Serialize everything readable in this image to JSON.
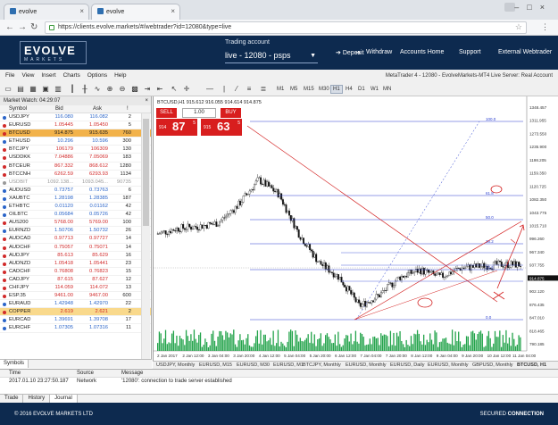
{
  "browser": {
    "tabs": [
      {
        "label": "evolve"
      },
      {
        "label": "evolve"
      }
    ],
    "url": "https://clients.evolve.markets/#/webtrader?id=12080&type=live"
  },
  "header": {
    "logo_main": "EVOLVE",
    "logo_sub": "MARKETS",
    "account_label": "Trading account",
    "account_value": "live - 12080 - psps",
    "nav": [
      "Deposit",
      "Withdraw",
      "Accounts Home",
      "Support",
      "External Webtrader"
    ]
  },
  "mt_menu": {
    "items": [
      "File",
      "View",
      "Insert",
      "Charts",
      "Options",
      "Help"
    ],
    "status": "MetaTrader 4 - 12080 - EvolveMarkets-MT4 Live Server: Real Account"
  },
  "timeframes": [
    "M1",
    "M5",
    "M15",
    "M30",
    "H1",
    "H4",
    "D1",
    "W1",
    "MN"
  ],
  "active_timeframe": "H1",
  "market_watch": {
    "title": "Market Watch: 04:29:07",
    "columns": [
      "Symbol",
      "Bid",
      "Ask",
      "!"
    ],
    "rows": [
      {
        "symbol": "USDJPY",
        "bid": "116.080",
        "ask": "116.082",
        "spread": "2",
        "color": "#2a64c8"
      },
      {
        "symbol": "EURUSD",
        "bid": "1.05445",
        "ask": "1.05450",
        "spread": "5",
        "color": "#d12a2a"
      },
      {
        "symbol": "BTCUSD",
        "bid": "914.875",
        "ask": "915.635",
        "spread": "760",
        "color": "#d12a2a",
        "highlight": true
      },
      {
        "symbol": "ETHUSD",
        "bid": "10.296",
        "ask": "10.596",
        "spread": "300",
        "color": "#2a64c8"
      },
      {
        "symbol": "BTCJPY",
        "bid": "106179",
        "ask": "106309",
        "spread": "130",
        "color": "#d12a2a"
      },
      {
        "symbol": "USDDKK",
        "bid": "7.04886",
        "ask": "7.05069",
        "spread": "183",
        "color": "#d12a2a"
      },
      {
        "symbol": "BTCEUR",
        "bid": "867.332",
        "ask": "868.612",
        "spread": "1280",
        "color": "#d12a2a"
      },
      {
        "symbol": "BTCCNH",
        "bid": "6262.59",
        "ask": "6293.93",
        "spread": "1134",
        "color": "#d12a2a"
      },
      {
        "symbol": "USDBIT",
        "bid": "1092.138...",
        "ask": "1093.045...",
        "spread": "90735",
        "color": "#999999",
        "grey": true
      },
      {
        "symbol": "AUDUSD",
        "bid": "0.73757",
        "ask": "0.73763",
        "spread": "6",
        "color": "#2a64c8"
      },
      {
        "symbol": "XAUBTC",
        "bid": "1.28198",
        "ask": "1.28385",
        "spread": "187",
        "color": "#2a64c8"
      },
      {
        "symbol": "ETHBTC",
        "bid": "0.01120",
        "ask": "0.01162",
        "spread": "42",
        "color": "#2a64c8"
      },
      {
        "symbol": "OILBTC",
        "bid": "0.05684",
        "ask": "0.05726",
        "spread": "42",
        "color": "#2a64c8"
      },
      {
        "symbol": "AUS200",
        "bid": "5768.00",
        "ask": "5769.00",
        "spread": "100",
        "color": "#d12a2a"
      },
      {
        "symbol": "EURNZD",
        "bid": "1.50706",
        "ask": "1.50732",
        "spread": "26",
        "color": "#2a64c8"
      },
      {
        "symbol": "AUDCAD",
        "bid": "0.97713",
        "ask": "0.97727",
        "spread": "14",
        "color": "#d12a2a"
      },
      {
        "symbol": "AUDCHF",
        "bid": "0.75057",
        "ask": "0.75071",
        "spread": "14",
        "color": "#d12a2a"
      },
      {
        "symbol": "AUDJPY",
        "bid": "85.613",
        "ask": "85.629",
        "spread": "16",
        "color": "#d12a2a"
      },
      {
        "symbol": "AUDNZD",
        "bid": "1.05418",
        "ask": "1.05441",
        "spread": "23",
        "color": "#d12a2a"
      },
      {
        "symbol": "CADCHF",
        "bid": "0.76808",
        "ask": "0.76823",
        "spread": "15",
        "color": "#d12a2a"
      },
      {
        "symbol": "CADJPY",
        "bid": "87.615",
        "ask": "87.627",
        "spread": "12",
        "color": "#d12a2a"
      },
      {
        "symbol": "CHFJPY",
        "bid": "114.059",
        "ask": "114.072",
        "spread": "13",
        "color": "#d12a2a"
      },
      {
        "symbol": "ESP.35",
        "bid": "9461.00",
        "ask": "9467.00",
        "spread": "600",
        "color": "#d12a2a"
      },
      {
        "symbol": "EURAUD",
        "bid": "1.42948",
        "ask": "1.42970",
        "spread": "22",
        "color": "#2a64c8"
      },
      {
        "symbol": "COPPER",
        "bid": "2.619",
        "ask": "2.621",
        "spread": "2",
        "color": "#d12a2a",
        "amber": true
      },
      {
        "symbol": "EURCAD",
        "bid": "1.39691",
        "ask": "1.39708",
        "spread": "17",
        "color": "#2a64c8"
      },
      {
        "symbol": "EURCHF",
        "bid": "1.07305",
        "ask": "1.07316",
        "spread": "11",
        "color": "#2a64c8"
      }
    ],
    "tab": "Symbols"
  },
  "chart": {
    "header": "BTCUSD,H1  915.612 916.055 914.614 914.875",
    "sell_label": "SELL",
    "buy_label": "BUY",
    "quantity": "1.00",
    "sell_price_small": "914",
    "sell_price_big": "87",
    "sell_price_sup": "5",
    "buy_price_small": "915",
    "buy_price_big": "63",
    "buy_price_sup": "5",
    "price_axis": [
      "1348.457",
      "1311.955",
      "1273.550",
      "1235.900",
      "1198.205",
      "1159.350",
      "1120.725",
      "1082.350",
      "1043.775",
      "1015.710",
      "996.260",
      "967.340",
      "937.755",
      "914.875",
      "902.120",
      "876.435",
      "847.010",
      "818.465",
      "790.185"
    ],
    "time_axis": [
      "2 Jan 2017",
      "2 Jan 12:00",
      "3 Jan 04:00",
      "3 Jan 20:00",
      "4 Jan 12:00",
      "5 Jan 04:00",
      "5 Jan 20:00",
      "6 Jan 12:00",
      "7 Jan 04:00",
      "7 Jan 20:00",
      "8 Jan 12:00",
      "9 Jan 04:00",
      "9 Jan 20:00",
      "10 Jan 12:00",
      "11 Jan 04:00"
    ],
    "fib_labels": [
      "100.0",
      "61.8",
      "50.0",
      "38.2",
      "23.6",
      "0.0"
    ],
    "tabs": [
      "USDJPY, Monthly",
      "EURUSD, M15",
      "EURUSD, M30",
      "EURUSD, M1",
      "BTCJPY, Monthly",
      "EURUSD, Monthly",
      "EURUSD, Daily",
      "EURUSD, Monthly",
      "GBPUSD, Monthly",
      "BTCUSD, H1"
    ]
  },
  "chart_data": {
    "type": "candlestick",
    "symbol": "BTCUSD",
    "timeframe": "H1",
    "x": [
      "2 Jan 2017",
      "2 Jan 12:00",
      "3 Jan 04:00",
      "3 Jan 20:00",
      "4 Jan 12:00",
      "5 Jan 04:00",
      "5 Jan 20:00",
      "6 Jan 12:00",
      "7 Jan 04:00",
      "7 Jan 20:00",
      "8 Jan 12:00",
      "9 Jan 04:00",
      "9 Jan 20:00",
      "10 Jan 12:00",
      "11 Jan 04:00"
    ],
    "close": [
      1000,
      1015,
      1020,
      1030,
      1080,
      1150,
      1110,
      1000,
      920,
      880,
      800,
      830,
      880,
      900,
      880,
      905,
      910,
      915,
      914.875
    ],
    "ylim": [
      770,
      1360
    ],
    "last_price": 914.875
  },
  "terminal": {
    "columns": [
      "Time",
      "Source",
      "Message"
    ],
    "row": {
      "time": "2017.01.10 23:27:50.187",
      "source": "Network",
      "message": "'12080': connection to trade server established"
    },
    "tabs": [
      "Trade",
      "History",
      "Journal"
    ],
    "active_tab": "Journal"
  },
  "footer": {
    "copyright": "© 2016 EVOLVE MARKETS LTD",
    "secured": "SECURED",
    "connection": "CONNECTION"
  }
}
